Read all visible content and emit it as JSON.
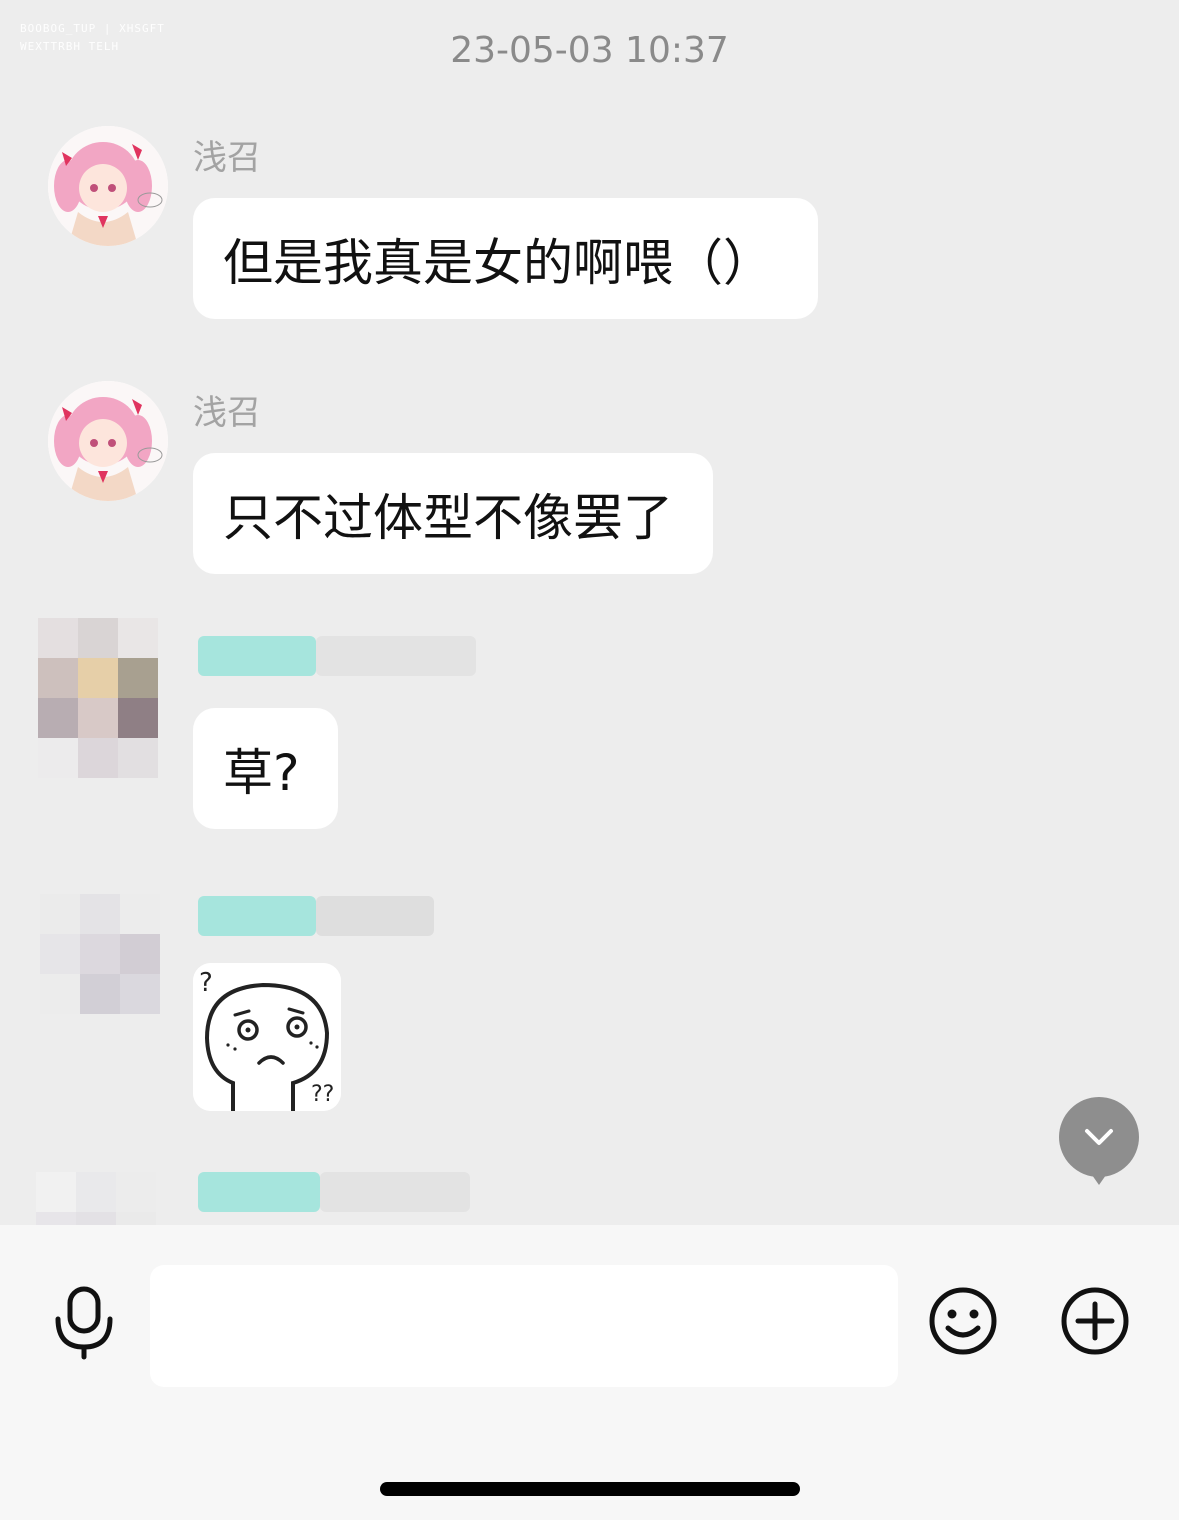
{
  "watermark": {
    "line1": "BOOBOG_TUP | XHSGFT",
    "line2": "WEXTTRBH TELH"
  },
  "chat": {
    "timestamp": "23-05-03 10:37",
    "messages": [
      {
        "sender": "浅召",
        "text": "但是我真是女的啊喂（）",
        "avatar": "anime-girl-pink-hair"
      },
      {
        "sender": "浅召",
        "text": "只不过体型不像罢了",
        "avatar": "anime-girl-pink-hair"
      },
      {
        "sender": "",
        "text": "草?",
        "avatar": "pixelated"
      },
      {
        "sender": "",
        "sticker": "confused-face-sticker",
        "avatar": "pixelated"
      },
      {
        "sender": "",
        "avatar": "pixelated"
      }
    ]
  },
  "colors": {
    "background": "#ededed",
    "bubble": "#ffffff",
    "name_blur": "#9ee3da",
    "scroll_button": "#8e8e8e"
  },
  "input_bar": {
    "placeholder": "",
    "voice_icon": "microphone-icon",
    "emoji_icon": "smiley-icon",
    "more_icon": "plus-circle-icon"
  }
}
